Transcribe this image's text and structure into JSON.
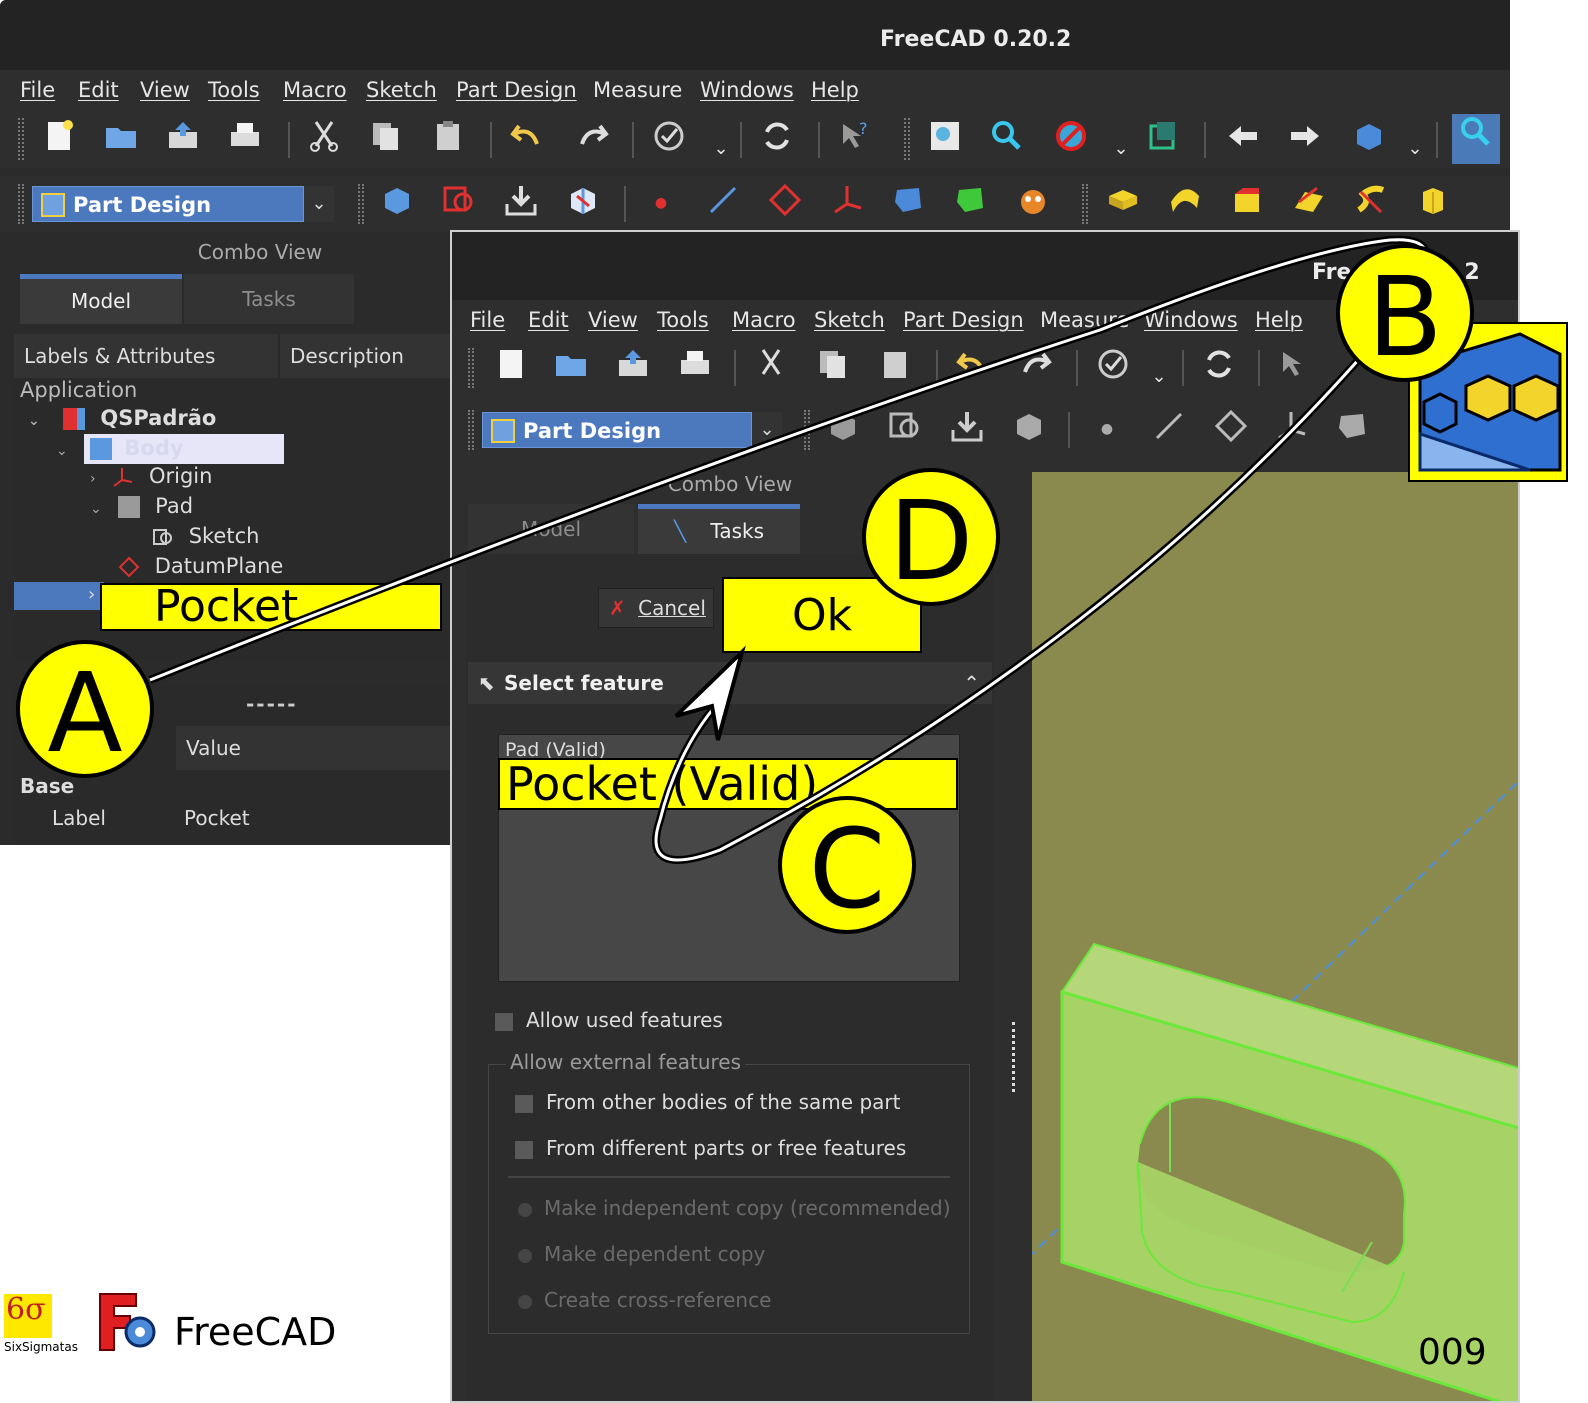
{
  "back_window": {
    "title": "FreeCAD 0.20.2",
    "menu": [
      "File",
      "Edit",
      "View",
      "Tools",
      "Macro",
      "Sketch",
      "Part Design",
      "Measure",
      "Windows",
      "Help"
    ],
    "workbench": "Part Design",
    "combo_view_title": "Combo View",
    "tabs": [
      "Model",
      "Tasks"
    ],
    "tree_headers": [
      "Labels & Attributes",
      "Description"
    ],
    "tree": {
      "application": "Application",
      "document": "QSPadrão",
      "body": "Body",
      "origin": "Origin",
      "pad": "Pad",
      "sketch": "Sketch",
      "datum": "DatumPlane"
    },
    "property_separator": "-----",
    "property_value_header": "Value",
    "property_group": "Base",
    "property_label": "Label",
    "property_label_value": "Pocket"
  },
  "front_window": {
    "title_visible": "Fre",
    "title_end": ".2",
    "menu": [
      "File",
      "Edit",
      "View",
      "Tools",
      "Macro",
      "Sketch",
      "Part Design",
      "Measure",
      "Windows",
      "Help"
    ],
    "workbench": "Part Design",
    "combo_view_title": "Combo View",
    "tabs": [
      "Model",
      "Tasks"
    ],
    "cancel_label": "Cancel",
    "select_feature_title": "Select feature",
    "feature_list": [
      "Pad (Valid)"
    ],
    "allow_used": "Allow used features",
    "allow_external": "Allow external features",
    "ext_options": [
      "From other bodies of the same part",
      "From different parts or free features"
    ],
    "copy_options": [
      "Make independent copy (recommended)",
      "Make dependent copy",
      "Create cross-reference"
    ]
  },
  "annotations": {
    "pocket_label": "Pocket",
    "ok_label": "Ok",
    "pocket_valid_label": "Pocket (Valid)",
    "circles": [
      "A",
      "B",
      "C",
      "D"
    ]
  },
  "footer": {
    "brand_small": "SixSigmatas",
    "brand_logo_text": "6σ",
    "freecad": "FreeCAD",
    "page_number": "009"
  }
}
